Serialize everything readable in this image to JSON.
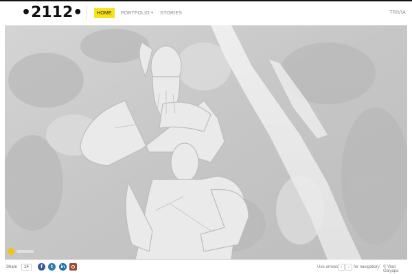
{
  "brand": {
    "logo_text": "2112"
  },
  "nav": {
    "items": [
      {
        "label": "HOME",
        "active": true
      },
      {
        "label": "PORTFOLIO",
        "has_dropdown": true
      },
      {
        "label": "STORIES"
      }
    ],
    "right_item": "TRIVIA",
    "active_color": "#f7e21a"
  },
  "hero": {
    "image_description": "Grayscale photo of carved stone statue figures in front of a waterfall",
    "play_button_color": "#f1c40f"
  },
  "footer": {
    "share_label": "Share",
    "share_count": "14",
    "social_icons": [
      "facebook-icon",
      "twitter-icon",
      "linkedin-icon",
      "instagram-icon"
    ],
    "nav_hint_left": "Use arrows",
    "key_left": "‹",
    "key_right": "›",
    "nav_hint_right": "for navigation",
    "credit": "© Vlad Galyapa"
  }
}
